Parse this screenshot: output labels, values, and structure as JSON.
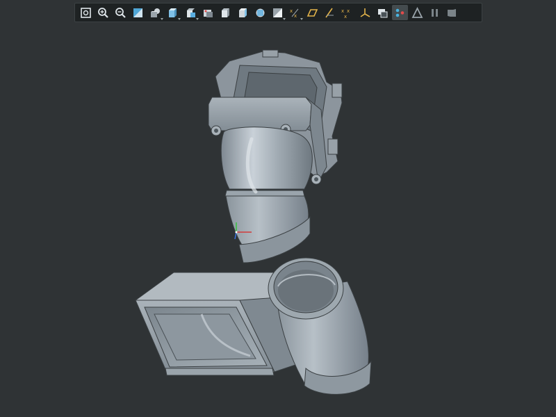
{
  "app": {
    "background": "#2f3335",
    "toolbar_bg": "#1e2223"
  },
  "toolbar": {
    "buttons": [
      {
        "id": "zoom-fit",
        "icon": "zoom-fit-icon"
      },
      {
        "id": "zoom-in",
        "icon": "zoom-in-icon"
      },
      {
        "id": "zoom-out",
        "icon": "zoom-out-icon"
      },
      {
        "id": "view-normal",
        "icon": "view-normal-icon"
      },
      {
        "id": "shaded-display",
        "icon": "shaded-display-icon",
        "dropdown": true
      },
      {
        "id": "front-view",
        "icon": "front-view-icon",
        "dropdown": true
      },
      {
        "id": "saved-views",
        "icon": "saved-views-icon",
        "dropdown": true
      },
      {
        "id": "perspective",
        "icon": "perspective-icon"
      },
      {
        "id": "appearance",
        "icon": "appearance-icon"
      },
      {
        "id": "display-style",
        "icon": "display-style-icon"
      },
      {
        "id": "section-view",
        "icon": "section-view-icon"
      },
      {
        "id": "hidden-line",
        "icon": "hidden-line-icon",
        "dropdown": true
      },
      {
        "id": "datum-points",
        "icon": "datum-points-icon",
        "dropdown": true
      },
      {
        "id": "datum-planes",
        "icon": "datum-planes-icon"
      },
      {
        "id": "datum-axes",
        "icon": "datum-axes-icon"
      },
      {
        "id": "point-display",
        "icon": "point-display-icon"
      },
      {
        "id": "csys-display",
        "icon": "csys-display-icon"
      },
      {
        "id": "annotation-display",
        "icon": "annotation-display-icon"
      },
      {
        "id": "spin-center",
        "icon": "spin-center-icon",
        "active": true
      },
      {
        "id": "render-triangle",
        "icon": "render-triangle-icon"
      },
      {
        "id": "pause",
        "icon": "pause-icon"
      },
      {
        "id": "flag",
        "icon": "flag-icon"
      }
    ]
  },
  "model": {
    "color": "#9fa9b1",
    "parts": [
      "top-elbow-assembly",
      "bottom-duct-adapter"
    ],
    "triad": {
      "x_color": "#d23b3b",
      "y_color": "#35c23c",
      "z_color": "#3a74e0"
    }
  }
}
